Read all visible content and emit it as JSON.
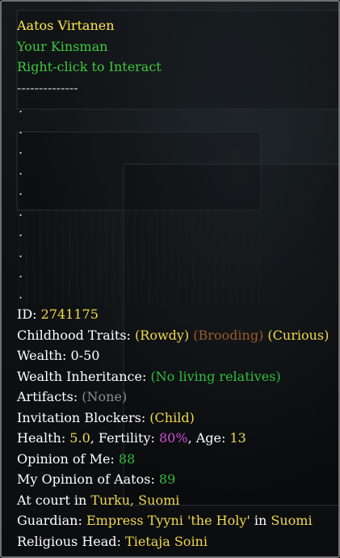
{
  "header": {
    "name": "Aatos Virtanen",
    "relation": "Your Kinsman",
    "hint": "Right-click to Interact",
    "separator": "--------------"
  },
  "placeholder_dot": ".",
  "id": {
    "label": "ID:",
    "value": "2741175"
  },
  "childhood_traits": {
    "label": "Childhood Traits:",
    "traits": [
      "(Rowdy)",
      "(Brooding)",
      "(Curious)"
    ]
  },
  "wealth": {
    "label": "Wealth:",
    "value": "0-50"
  },
  "wealth_inheritance": {
    "label": "Wealth Inheritance:",
    "value": "(No living relatives)"
  },
  "artifacts": {
    "label": "Artifacts:",
    "value": "(None)"
  },
  "invitation_blockers": {
    "label": "Invitation Blockers:",
    "value": "(Child)"
  },
  "stats": {
    "health_label": "Health:",
    "health_value": "5.0",
    "fertility_label": ", Fertility:",
    "fertility_value": "80%",
    "age_label": ", Age:",
    "age_value": "13"
  },
  "opinion_of_me": {
    "label": "Opinion of Me:",
    "value": "88"
  },
  "my_opinion": {
    "label": "My Opinion of Aatos:",
    "value": "89"
  },
  "court": {
    "label": "At court in",
    "value": "Turku, Suomi"
  },
  "guardian": {
    "label": "Guardian:",
    "name": "Empress Tyyni 'the Holy'",
    "connector": "in",
    "place": "Suomi"
  },
  "religious_head": {
    "label": "Religious Head:",
    "value": "Tietaja Soini"
  },
  "colors": {
    "name": "#ffe64d",
    "green": "#3ec93e",
    "yellow": "#f2d94c",
    "grey": "#8d8d8d",
    "brown": "#9b5b2d",
    "magenta": "#d44bd4",
    "border": "#6f6f6f"
  }
}
